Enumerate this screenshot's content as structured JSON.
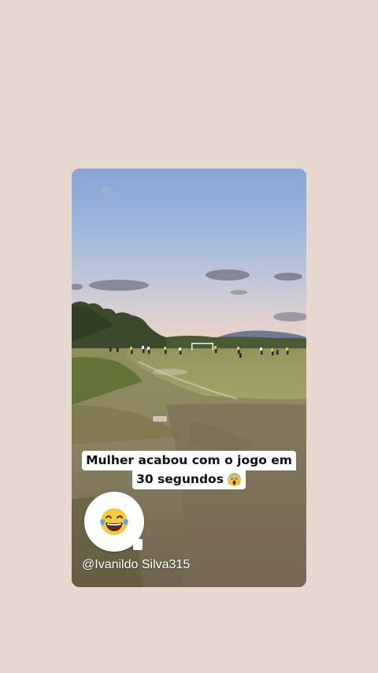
{
  "story": {
    "caption_line1": "Mulher acabou com o jogo em",
    "caption_line2": "30 segundos",
    "caption_emoji": "face-screaming-in-fear-icon",
    "sticker_emoji": "face-with-tears-of-joy-icon",
    "handle": "@Ivanildo Silva315"
  },
  "colors": {
    "page_background": "#e6d8d0",
    "caption_background": "#ffffff",
    "caption_text": "#111111",
    "handle_text": "#ffffff"
  }
}
